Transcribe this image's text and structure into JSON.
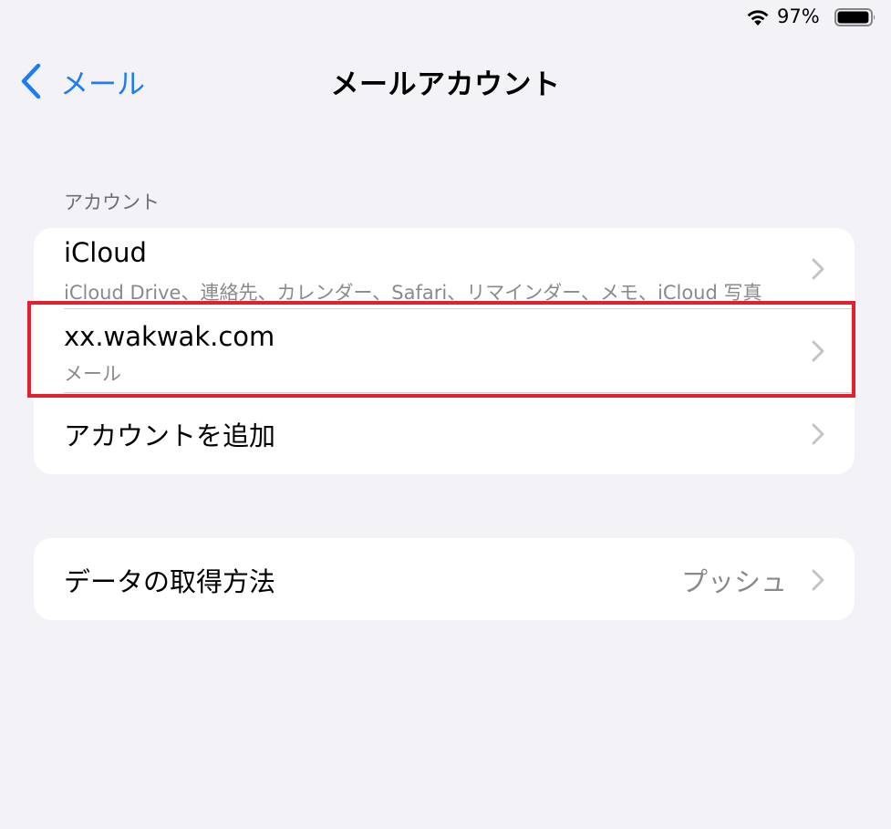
{
  "status_bar": {
    "battery_percent": "97%",
    "battery_level": 0.97,
    "icons": [
      "wifi-icon",
      "battery-icon"
    ]
  },
  "nav": {
    "back_label": "メール",
    "title": "メールアカウント",
    "accent_color": "#1b7cf6"
  },
  "accounts_section": {
    "header": "アカウント",
    "items": [
      {
        "title": "iCloud",
        "subtitle": "iCloud Drive、連絡先、カレンダー、Safari、リマインダー、メモ、iCloud 写真"
      },
      {
        "title": "xx.wakwak.com",
        "subtitle": "メール"
      }
    ],
    "add_account_label": "アカウントを追加"
  },
  "fetch_section": {
    "label": "データの取得方法",
    "value": "プッシュ"
  },
  "annotation": {
    "highlight_color": "#e4202e"
  }
}
